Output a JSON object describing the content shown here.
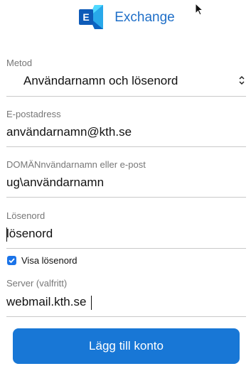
{
  "header": {
    "brand": "Exchange",
    "logo_icon": "exchange-logo-icon"
  },
  "form": {
    "method": {
      "label": "Metod",
      "value": "Användarnamn och lösenord"
    },
    "email": {
      "label": "E-postadress",
      "value": "användarnamn@kth.se"
    },
    "domain_user": {
      "label": "DOMÄNnvändarnamn eller e-post",
      "value": "ug\\användarnamn"
    },
    "password": {
      "label": "Lösenord",
      "value": "lösenord"
    },
    "show_password": {
      "label": "Visa lösenord",
      "checked": true
    },
    "server": {
      "label": "Server (valfritt)",
      "value": "webmail.kth.se"
    }
  },
  "actions": {
    "add_account": "Lägg till konto"
  },
  "colors": {
    "accent": "#1877d6",
    "brand": "#1f6fc8"
  }
}
